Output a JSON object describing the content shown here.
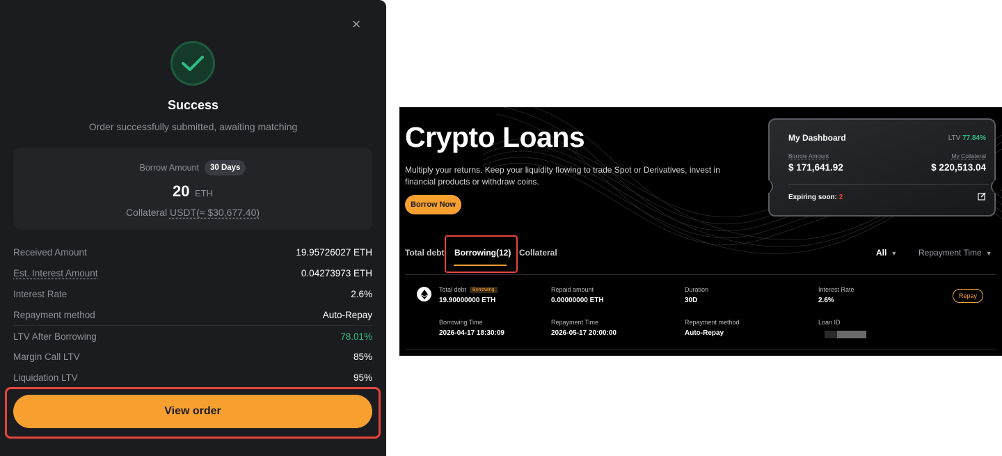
{
  "modal": {
    "close_symbol": "×",
    "title": "Success",
    "subtitle": "Order successfully submitted, awaiting matching",
    "summary": {
      "borrow_amount_label": "Borrow Amount",
      "term_badge": "30 Days",
      "amount": "20",
      "amount_unit": "ETH",
      "collateral_label": "Collateral",
      "collateral_value": "USDT(≈ $30,677.40)"
    },
    "details": [
      {
        "label": "Received Amount",
        "value": "19.95726027 ETH"
      },
      {
        "label": "Est. Interest Amount",
        "value": "0.04273973 ETH"
      },
      {
        "label": "Interest Rate",
        "value": "2.6%"
      },
      {
        "label": "Repayment method",
        "value": "Auto-Repay"
      },
      {
        "label": "LTV After Borrowing",
        "value": "78.01%"
      },
      {
        "label": "Margin Call LTV",
        "value": "85%"
      },
      {
        "label": "Liquidation LTV",
        "value": "95%"
      }
    ],
    "view_order_label": "View order",
    "colors": {
      "accent": "#f7a030",
      "success": "#2ebd85",
      "highlight": "#e5453b",
      "background": "#1b1c1f"
    }
  },
  "loans": {
    "title": "Crypto Loans",
    "description": "Multiply your returns. Keep your liquidity flowing to trade Spot or Derivatives, invest in financial products or withdraw coins.",
    "borrow_now_label": "Borrow Now",
    "dashboard": {
      "title": "My Dashboard",
      "ltv_label": "LTV",
      "ltv_value": "77.84%",
      "borrow_amount_label": "Borrow Amount",
      "borrow_amount_value": "$ 171,641.92",
      "collateral_label": "My Collateral",
      "collateral_value": "$ 220,513.04",
      "expiring_label": "Expiring soon:",
      "expiring_count": "2"
    },
    "tabs": [
      {
        "label": "Total debt"
      },
      {
        "label": "Borrowing(12)"
      },
      {
        "label": "Collateral"
      }
    ],
    "filters": {
      "status": "All",
      "sort": "Repayment Time"
    },
    "loan": {
      "total_debt_label": "Total debt",
      "status_badge": "Borrowing",
      "total_debt_value": "19.90000000 ETH",
      "repaid_label": "Repaid amount",
      "repaid_value": "0.00000000 ETH",
      "duration_label": "Duration",
      "duration_value": "30D",
      "interest_label": "Interest Rate",
      "interest_value": "2.6%",
      "repay_button": "Repay",
      "borrowing_time_label": "Borrowing Time",
      "borrowing_time_value": "2026-04-17 18:30:09",
      "repayment_time_label": "Repayment Time",
      "repayment_time_value": "2026-05-17 20:00:00",
      "repayment_method_label": "Repayment method",
      "repayment_method_value": "Auto-Repay",
      "loan_id_label": "Loan ID"
    }
  }
}
